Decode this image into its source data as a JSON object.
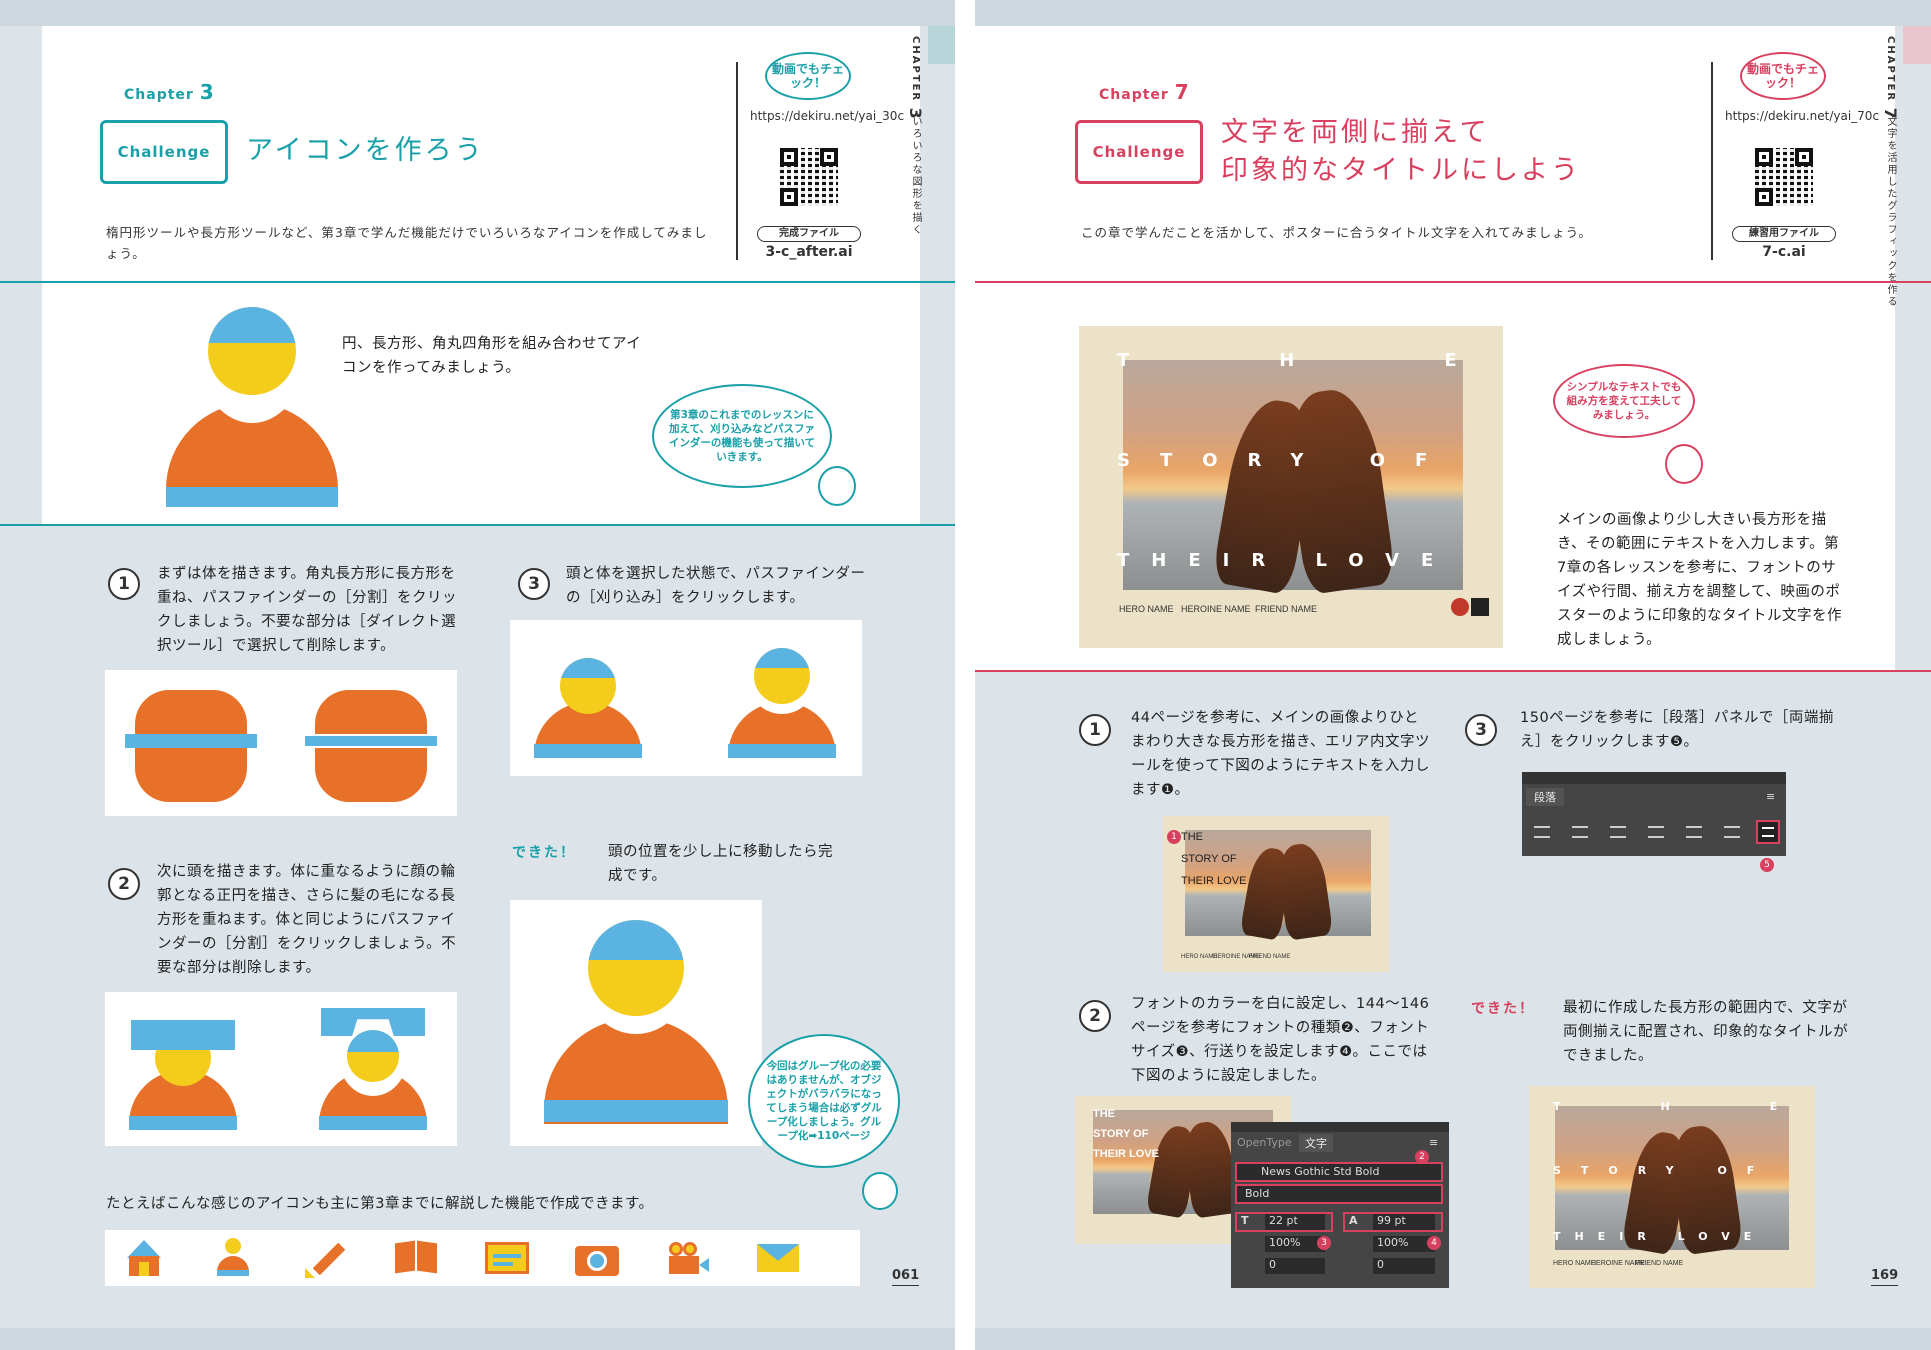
{
  "left_page": {
    "chapter_label": "Chapter",
    "chapter_num": "3",
    "challenge_label": "Challenge",
    "title": "アイコンを作ろう",
    "lead": "楕円形ツールや長方形ツールなど、第3章で学んだ機能だけでいろいろなアイコンを作成してみましょう。",
    "video_bubble": "動画でもチェック！",
    "url": "https://dekiru.net/yai_30c",
    "file_label": "完成ファイル",
    "file_name": "3-c_after.ai",
    "side_title": "いろいろな図形を描く",
    "side_chapter": "CHAPTER",
    "intro": "円、長方形、角丸四角形を組み合わせてアイコンを作ってみましょう。",
    "speech1": "第3章のこれまでのレッスンに加えて、刈り込みなどパスファインダーの機能も使って描いていきます。",
    "step1_num": "1",
    "step1": "まずは体を描きます。角丸長方形に長方形を重ね、パスファインダーの［分割］をクリックしましょう。不要な部分は［ダイレクト選択ツール］で選択して削除します。",
    "step2_num": "2",
    "step2": "次に頭を描きます。体に重なるように顔の輪郭となる正円を描き、さらに髪の毛になる長方形を重ねます。体と同じようにパスファインダーの［分割］をクリックしましょう。不要な部分は削除します。",
    "step3_num": "3",
    "step3": "頭と体を選択した状態で、パスファインダーの［刈り込み］をクリックします。",
    "done_label": "できた！",
    "done_text": "頭の位置を少し上に移動したら完成です。",
    "speech2": "今回はグループ化の必要はありませんが、オブジェクトがバラバラになってしまう場合は必ずグループ化しましょう。グループ化➡110ページ",
    "bottom_text": "たとえばこんな感じのアイコンも主に第3章までに解説した機能で作成できます。",
    "page_number": "061",
    "icons": [
      "house-icon",
      "person-icon",
      "pencil-icon",
      "book-icon",
      "window-icon",
      "camera-icon",
      "video-camera-icon",
      "envelope-icon"
    ]
  },
  "right_page": {
    "chapter_label": "Chapter",
    "chapter_num": "7",
    "challenge_label": "Challenge",
    "title_line1": "文字を両側に揃えて",
    "title_line2": "印象的なタイトルにしよう",
    "lead": "この章で学んだことを活かして、ポスターに合うタイトル文字を入れてみましょう。",
    "video_bubble": "動画でもチェック！",
    "url": "https://dekiru.net/yai_70c",
    "file_label": "練習用ファイル",
    "file_name": "7-c.ai",
    "side_title": "文字を活用したグラフィックを作る",
    "side_chapter": "CHAPTER",
    "poster": {
      "line1": "THE",
      "line2": "STORY OF",
      "line3": "THEIR LOVE",
      "credits": [
        "HERO NAME",
        "HEROINE NAME",
        "FRIEND NAME"
      ]
    },
    "speech1": "シンプルなテキストでも組み方を変えて工夫してみましょう。",
    "intro": "メインの画像より少し大きい長方形を描き、その範囲にテキストを入力します。第7章の各レッスンを参考に、フォントのサイズや行間、揃え方を調整して、映画のポスターのように印象的なタイトル文字を作成しましょう。",
    "step1_num": "1",
    "step1": "44ページを参考に、メインの画像よりひとまわり大きな長方形を描き、エリア内文字ツールを使って下図のようにテキストを入力します❶。",
    "step2_num": "2",
    "step2": "フォントのカラーを白に設定し、144〜146ページを参考にフォントの種類❷、フォントサイズ❸、行送りを設定します❹。ここでは下図のように設定しました。",
    "step3_num": "3",
    "step3": "150ページを参考に［段落］パネルで［両端揃え］をクリックします❺。",
    "done_label": "できた！",
    "done_text": "最初に作成した長方形の範囲内で、文字が両側揃えに配置され、印象的なタイトルができました。",
    "panel_para": {
      "tab": "段落",
      "marker": "5"
    },
    "panel_char": {
      "tab1": "OpenType",
      "tab2": "文字",
      "font": "News Gothic Std Bold",
      "style": "Bold",
      "size": "22 pt",
      "leading": "99 pt",
      "vscale": "100%",
      "hscale": "100%",
      "kern": "0",
      "track": "0",
      "m2": "2",
      "m3": "3",
      "m4": "4"
    },
    "marker1": "1",
    "page_number": "169"
  },
  "colors": {
    "teal": "#1aa0a8",
    "red": "#d8405f",
    "orange": "#e8712a",
    "blue": "#5ab3e0",
    "yellow": "#f4cc1c"
  }
}
